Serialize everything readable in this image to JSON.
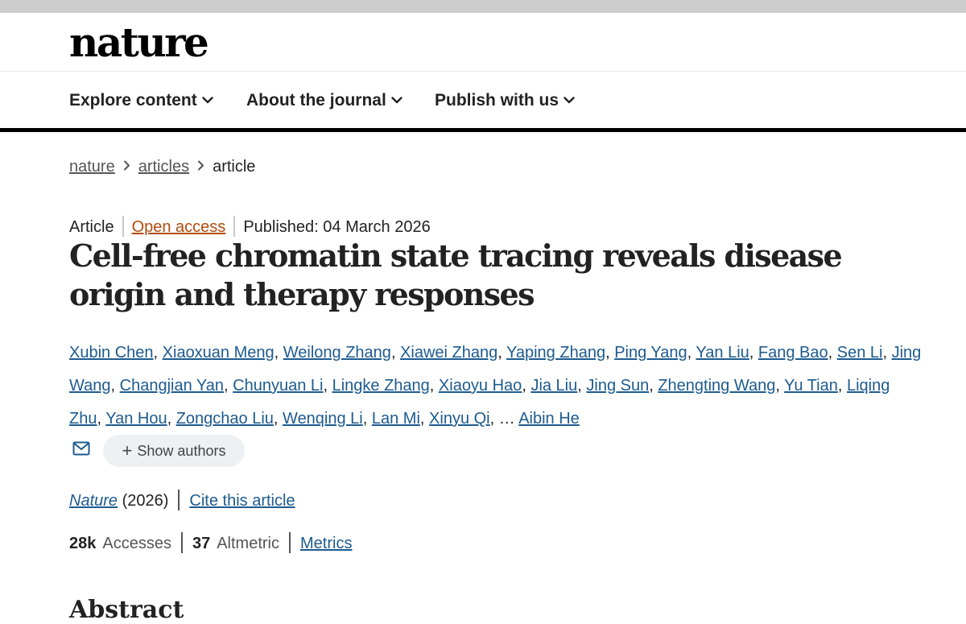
{
  "header": {
    "logo": "nature"
  },
  "nav": {
    "items": [
      {
        "label": "Explore content"
      },
      {
        "label": "About the journal"
      },
      {
        "label": "Publish with us"
      }
    ]
  },
  "breadcrumb": {
    "items": [
      "nature",
      "articles",
      "article"
    ]
  },
  "article": {
    "type": "Article",
    "access": "Open access",
    "published": "Published: 04 March 2026",
    "title": "Cell-free chromatin state tracing reveals disease origin and therapy responses",
    "authors": [
      "Xubin Chen",
      "Xiaoxuan Meng",
      "Weilong Zhang",
      "Xiawei Zhang",
      "Yaping Zhang",
      "Ping Yang",
      "Yan Liu",
      "Fang Bao",
      "Sen Li",
      "Jing Wang",
      "Changjian Yan",
      "Chunyuan Li",
      "Lingke Zhang",
      "Xiaoyu Hao",
      "Jia Liu",
      "Jing Sun",
      "Zhengting Wang",
      "Yu Tian",
      "Liqing Zhu",
      "Yan Hou",
      "Zongchao Liu",
      "Wenqing Li",
      "Lan Mi",
      "Xinyu Qi"
    ],
    "ellipsis": "…",
    "last_author": "Aibin He",
    "show_authors": "Show authors",
    "journal": "Nature",
    "year": "(2026)",
    "cite": "Cite this article",
    "metrics": {
      "accesses_value": "28k",
      "accesses_label": "Accesses",
      "altmetric_value": "37",
      "altmetric_label": "Altmetric",
      "metrics_link": "Metrics"
    },
    "next_heading": "Abstract"
  },
  "icons": {
    "nav_chevron": "chevron-down-icon",
    "breadcrumb_sep": "chevron-right-icon",
    "mail": "mail-icon",
    "plus": "plus-icon"
  },
  "colors": {
    "link": "#1d5b8f",
    "open_access": "#b24a10",
    "text": "#222222"
  }
}
